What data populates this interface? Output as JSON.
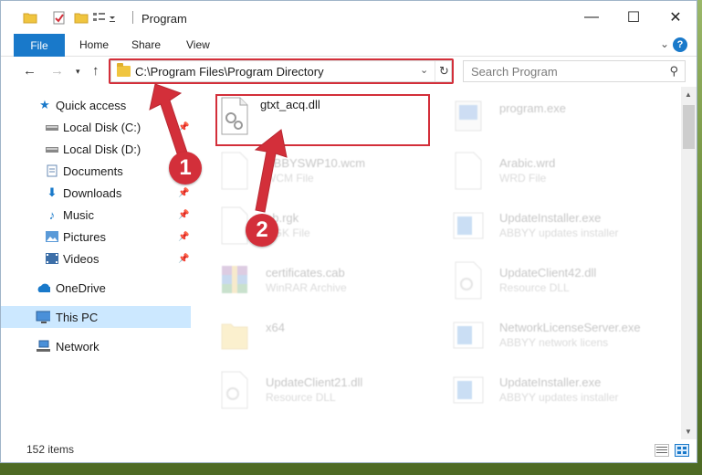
{
  "window": {
    "title": "Program",
    "controls": {
      "minimize": "—",
      "maximize": "☐",
      "close": "✕"
    }
  },
  "ribbon": {
    "tabs": [
      "File",
      "Home",
      "Share",
      "View"
    ],
    "expand_icon": "chevron-down-icon",
    "help_icon": "help-icon",
    "help_label": "?"
  },
  "nav": {
    "address": "C:\\Program Files\\Program Directory",
    "search_placeholder": "Search Program"
  },
  "sidebar": {
    "items": [
      {
        "label": "Quick access",
        "icon": "star-icon",
        "pinned": false
      },
      {
        "label": "Local Disk (C:)",
        "icon": "drive-icon",
        "pinned": true
      },
      {
        "label": "Local Disk (D:)",
        "icon": "drive-icon",
        "pinned": false
      },
      {
        "label": "Documents",
        "icon": "documents-icon",
        "pinned": true
      },
      {
        "label": "Downloads",
        "icon": "download-icon",
        "pinned": true
      },
      {
        "label": "Music",
        "icon": "music-icon",
        "pinned": true
      },
      {
        "label": "Pictures",
        "icon": "pictures-icon",
        "pinned": true
      },
      {
        "label": "Videos",
        "icon": "videos-icon",
        "pinned": true
      },
      {
        "label": "OneDrive",
        "icon": "cloud-icon",
        "pinned": false
      },
      {
        "label": "This PC",
        "icon": "computer-icon",
        "pinned": false,
        "selected": true
      },
      {
        "label": "Network",
        "icon": "network-icon",
        "pinned": false
      }
    ]
  },
  "files": [
    {
      "name": "gtxt_acq.dll",
      "sub": "",
      "icon": "dll-file-icon",
      "selected": true,
      "faded": false
    },
    {
      "name": "program.exe",
      "sub": "",
      "icon": "exe-file-icon",
      "faded": true
    },
    {
      "name": "ABBYSWP10.wcm",
      "sub": "WCM File",
      "icon": "file-icon",
      "faded": true
    },
    {
      "name": "Arabic.wrd",
      "sub": "WRD File",
      "icon": "file-icon",
      "faded": true
    },
    {
      "name": "ab.rgk",
      "sub": "RGK File",
      "icon": "file-icon",
      "faded": true
    },
    {
      "name": "UpdateInstaller.exe",
      "sub": "ABBYY updates installer",
      "icon": "installer-icon",
      "faded": true
    },
    {
      "name": "certificates.cab",
      "sub": "WinRAR Archive",
      "icon": "archive-icon",
      "faded": true
    },
    {
      "name": "UpdateClient42.dll",
      "sub": "Resource DLL",
      "icon": "dll-file-icon",
      "faded": true
    },
    {
      "name": "x64",
      "sub": "",
      "icon": "folder-icon",
      "faded": true
    },
    {
      "name": "NetworkLicenseServer.exe",
      "sub": "ABBYY network licens",
      "icon": "installer-icon",
      "faded": true
    },
    {
      "name": "UpdateClient21.dll",
      "sub": "Resource DLL",
      "icon": "dll-file-icon",
      "faded": true
    },
    {
      "name": "UpdateInstaller.exe",
      "sub": "ABBYY updates installer",
      "icon": "installer-icon",
      "faded": true
    }
  ],
  "status": {
    "items": "152 items"
  },
  "callouts": [
    "1",
    "2"
  ],
  "colors": {
    "accent": "#1979ca",
    "callout": "#d32f3a",
    "selected_nav": "#cce8ff"
  }
}
